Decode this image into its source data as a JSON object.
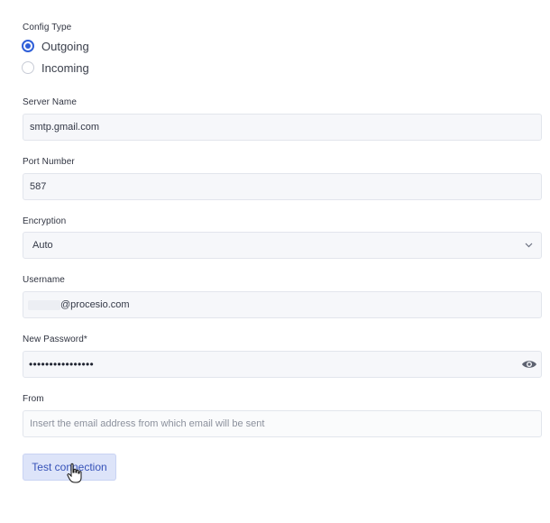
{
  "config_type": {
    "label": "Config Type",
    "options": [
      {
        "label": "Outgoing",
        "selected": true
      },
      {
        "label": "Incoming",
        "selected": false
      }
    ]
  },
  "server_name": {
    "label": "Server Name",
    "value": "smtp.gmail.com"
  },
  "port_number": {
    "label": "Port Number",
    "value": "587"
  },
  "encryption": {
    "label": "Encryption",
    "value": "Auto"
  },
  "username": {
    "label": "Username",
    "value_suffix": "@procesio.com"
  },
  "new_password": {
    "label": "New Password*",
    "masked_value": "••••••••••••••••"
  },
  "from": {
    "label": "From",
    "placeholder": "Insert the email address from which email will be sent"
  },
  "test_connection": {
    "label": "Test connection"
  },
  "colors": {
    "accent": "#2f5fd8",
    "button_bg": "#dde4f9",
    "field_bg": "#f6f7fa"
  }
}
